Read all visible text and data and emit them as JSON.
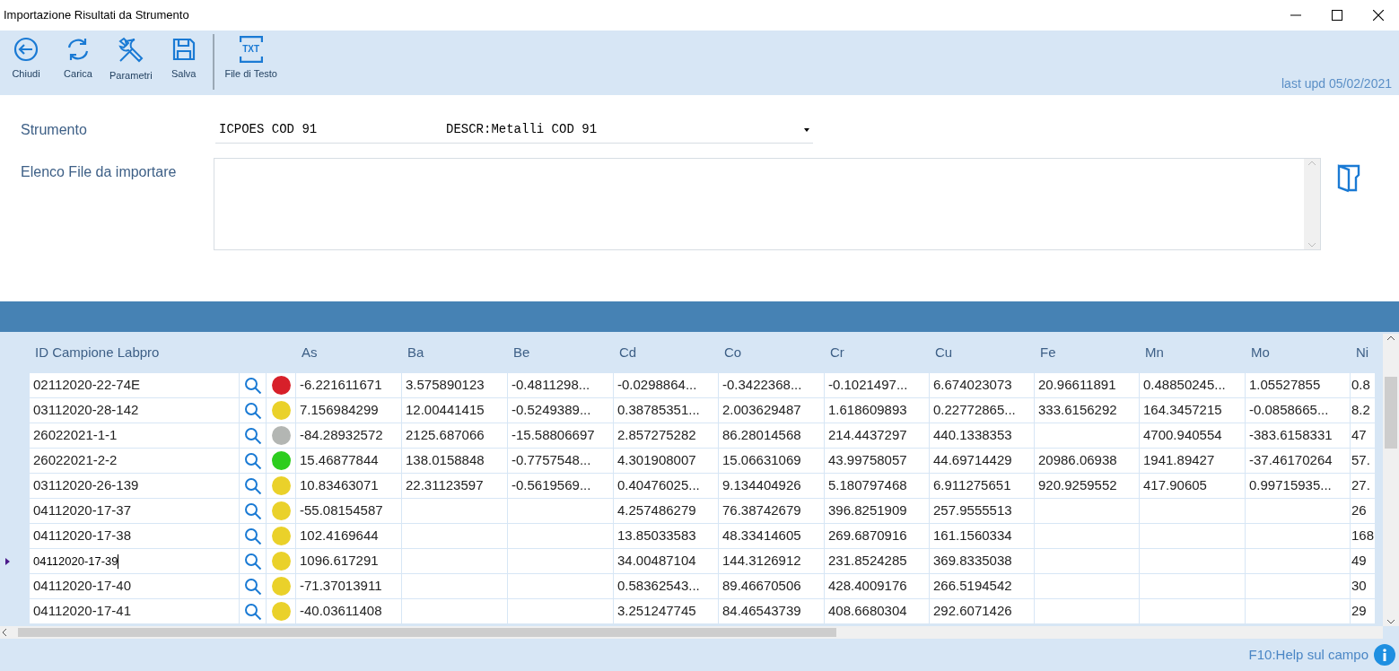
{
  "window": {
    "title": "Importazione Risultati da Strumento"
  },
  "toolbar": {
    "buttons": [
      {
        "kind": "close",
        "label": "Chiudi"
      },
      {
        "kind": "reload",
        "label": "Carica"
      },
      {
        "kind": "tools",
        "label": "Parametri"
      },
      {
        "kind": "save",
        "label": "Salva"
      },
      {
        "kind": "text-file",
        "label": "File di Testo",
        "icon_text": "TXT"
      }
    ],
    "last_update": "last upd 05/02/2021"
  },
  "form": {
    "strumento": {
      "label": "Strumento",
      "value": "ICPOES COD 91",
      "description": "DESCR:Metalli COD 91"
    },
    "file_list": {
      "label": "Elenco File da importare"
    }
  },
  "table": {
    "columns": [
      "ID Campione Labpro",
      "As",
      "Ba",
      "Be",
      "Cd",
      "Co",
      "Cr",
      "Cu",
      "Fe",
      "Mn",
      "Mo",
      "Ni"
    ],
    "rows": [
      {
        "id": "02112020-22-74E",
        "color": "#d7202a",
        "current": false,
        "values": {
          "as": "-6.221611671",
          "ba": "3.575890123",
          "be": "-0.4811298...",
          "cd": "-0.0298864...",
          "co": "-0.3422368...",
          "cr": "-0.1021497...",
          "cu": "6.674023073",
          "fe": "20.96611891",
          "mn": "0.48850245...",
          "mo": "1.05527855",
          "ni": "0.8"
        }
      },
      {
        "id": "03112020-28-142",
        "color": "#ead12a",
        "current": false,
        "values": {
          "as": "7.156984299",
          "ba": "12.00441415",
          "be": "-0.5249389...",
          "cd": "0.38785351...",
          "co": "2.003629487",
          "cr": "1.618609893",
          "cu": "0.22772865...",
          "fe": "333.6156292",
          "mn": "164.3457215",
          "mo": "-0.0858665...",
          "ni": "8.2"
        }
      },
      {
        "id": "26022021-1-1",
        "color": "#b3b6b3",
        "current": false,
        "values": {
          "as": "-84.28932572",
          "ba": "2125.687066",
          "be": "-15.58806697",
          "cd": "2.857275282",
          "co": "86.28014568",
          "cr": "214.4437297",
          "cu": "440.1338353",
          "mn": "4700.940554",
          "mo": "-383.6158331",
          "ni": "47"
        }
      },
      {
        "id": "26022021-2-2",
        "color": "#2dcd1e",
        "current": false,
        "values": {
          "as": "15.46877844",
          "ba": "138.0158848",
          "be": "-0.7757548...",
          "cd": "4.301908007",
          "co": "15.06631069",
          "cr": "43.99758057",
          "cu": "44.69714429",
          "fe": "20986.06938",
          "mn": "1941.89427",
          "mo": "-37.46170264",
          "ni": "57."
        }
      },
      {
        "id": "03112020-26-139",
        "color": "#ead12a",
        "current": false,
        "values": {
          "as": "10.83463071",
          "ba": "22.31123597",
          "be": "-0.5619569...",
          "cd": "0.40476025...",
          "co": "9.134404926",
          "cr": "5.180797468",
          "cu": "6.911275651",
          "fe": "920.9259552",
          "mn": "417.90605",
          "mo": "0.99715935...",
          "ni": "27."
        }
      },
      {
        "id": "04112020-17-37",
        "color": "#ead12a",
        "current": false,
        "values": {
          "as": "-55.08154587",
          "cd": "4.257486279",
          "co": "76.38742679",
          "cr": "396.8251909",
          "cu": "257.9555513",
          "ni": "26"
        }
      },
      {
        "id": "04112020-17-38",
        "color": "#ead12a",
        "current": false,
        "values": {
          "as": "102.4169644",
          "cd": "13.85033583",
          "co": "48.33414605",
          "cr": "269.6870916",
          "cu": "161.1560334",
          "ni": "168"
        }
      },
      {
        "id": "04112020-17-39",
        "color": "#ead12a",
        "current": true,
        "values": {
          "as": "1096.617291",
          "cd": "34.00487104",
          "co": "144.3126912",
          "cr": "231.8524285",
          "cu": "369.8335038",
          "ni": "49"
        }
      },
      {
        "id": "04112020-17-40",
        "color": "#ead12a",
        "current": false,
        "values": {
          "as": "-71.37013911",
          "cd": "0.58362543...",
          "co": "89.46670506",
          "cr": "428.4009176",
          "cu": "266.5194542",
          "ni": "30"
        }
      },
      {
        "id": "04112020-17-41",
        "color": "#ead12a",
        "current": false,
        "values": {
          "as": "-40.03611408",
          "cd": "3.251247745",
          "co": "84.46543739",
          "cr": "408.6680304",
          "cu": "292.6071426",
          "ni": "29"
        }
      }
    ]
  },
  "status_bar": {
    "help": "F10:Help sul campo"
  }
}
